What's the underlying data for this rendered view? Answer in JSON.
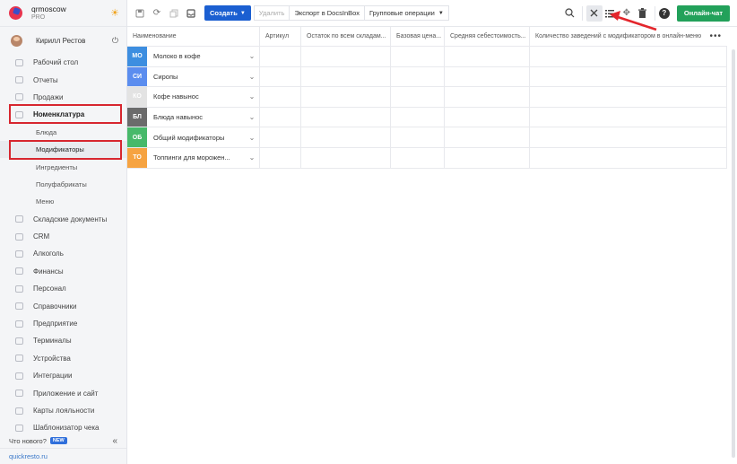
{
  "brand": {
    "name": "qrmoscow",
    "plan": "PRO"
  },
  "user": {
    "name": "Кирилл Рестов"
  },
  "sidebar": {
    "items": [
      {
        "label": "Рабочий стол",
        "icon": "dashboard-icon"
      },
      {
        "label": "Отчеты",
        "icon": "reports-icon"
      },
      {
        "label": "Продажи",
        "icon": "sales-icon"
      },
      {
        "label": "Номенклатура",
        "icon": "nomenclature-icon",
        "highlighted": true
      },
      {
        "label": "Блюда",
        "sub": true
      },
      {
        "label": "Модификаторы",
        "sub": true,
        "highlighted": true
      },
      {
        "label": "Ингредиенты",
        "sub": true
      },
      {
        "label": "Полуфабрикаты",
        "sub": true
      },
      {
        "label": "Меню",
        "sub": true
      },
      {
        "label": "Складские документы",
        "icon": "warehouse-icon"
      },
      {
        "label": "CRM",
        "icon": "crm-icon"
      },
      {
        "label": "Алкоголь",
        "icon": "alcohol-icon"
      },
      {
        "label": "Финансы",
        "icon": "finance-icon"
      },
      {
        "label": "Персонал",
        "icon": "staff-icon"
      },
      {
        "label": "Справочники",
        "icon": "directory-icon"
      },
      {
        "label": "Предприятие",
        "icon": "enterprise-icon"
      },
      {
        "label": "Терминалы",
        "icon": "terminal-icon"
      },
      {
        "label": "Устройства",
        "icon": "devices-icon"
      },
      {
        "label": "Интеграции",
        "icon": "integrations-icon"
      },
      {
        "label": "Приложение и сайт",
        "icon": "app-icon"
      },
      {
        "label": "Карты лояльности",
        "icon": "loyalty-icon"
      },
      {
        "label": "Шаблонизатор чека",
        "icon": "receipt-icon"
      }
    ],
    "whatsnew": "Что нового?",
    "new_badge": "NEW",
    "site": "quickresto.ru"
  },
  "toolbar": {
    "create": "Создать",
    "delete": "Удалить",
    "export": "Экспорт в DocsInBox",
    "group_ops": "Групповые операции",
    "chat": "Онлайн-чат"
  },
  "table": {
    "columns": [
      "Наименование",
      "Артикул",
      "Остаток по всем складам...",
      "Базовая цена...",
      "Средняя себестоимость...",
      "Количество заведений с модификатором в онлайн-меню"
    ],
    "rows": [
      {
        "abbr": "МО",
        "name": "Молоко в кофе",
        "color": "#3d8ee0"
      },
      {
        "abbr": "СИ",
        "name": "Сиропы",
        "color": "#5b8def"
      },
      {
        "abbr": "КО",
        "name": "Кофе навынос",
        "color": "#e3e3e3"
      },
      {
        "abbr": "БЛ",
        "name": "Блюда навынос",
        "color": "#6b6b6b"
      },
      {
        "abbr": "ОБ",
        "name": "Общий модификаторы",
        "color": "#47b96a"
      },
      {
        "abbr": "ТО",
        "name": "Топпинги для морожен...",
        "color": "#f6a341"
      }
    ]
  },
  "colors": {
    "accent": "#1b5fd1",
    "chat": "#22a15a",
    "highlight": "#d7262f"
  }
}
